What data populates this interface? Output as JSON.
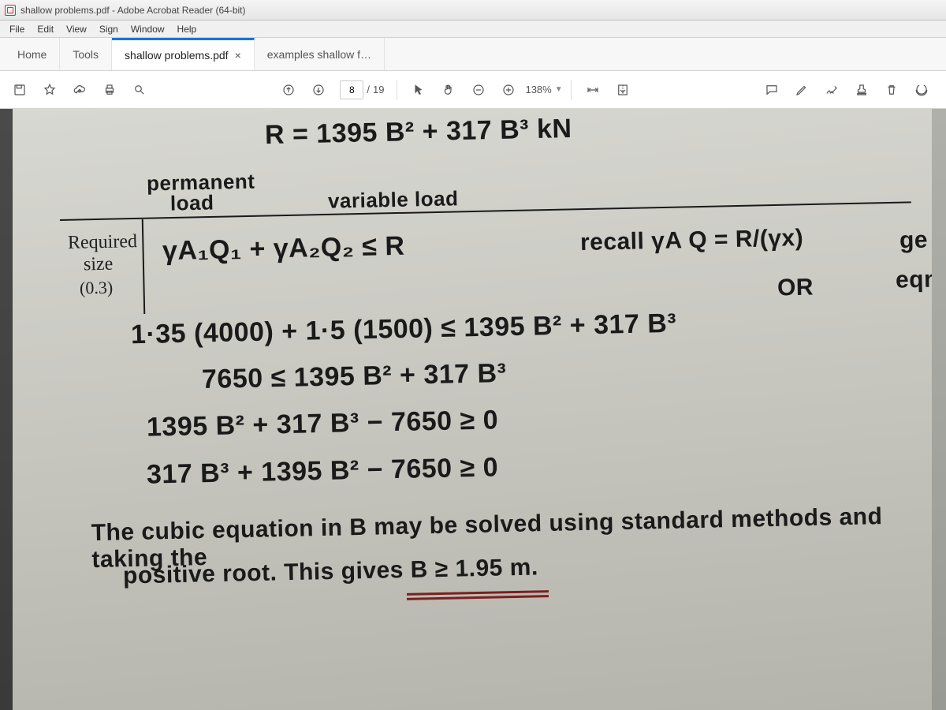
{
  "window": {
    "title": "shallow problems.pdf - Adobe Acrobat Reader (64-bit)"
  },
  "menu": {
    "file": "File",
    "edit": "Edit",
    "view": "View",
    "sign": "Sign",
    "window": "Window",
    "help": "Help"
  },
  "tabs": {
    "home": "Home",
    "tools": "Tools",
    "doc_active": "shallow problems.pdf",
    "doc_other": "examples shallow f…"
  },
  "toolbar": {
    "page_current": "8",
    "page_sep": "/",
    "page_total": "19",
    "zoom": "138%"
  },
  "document": {
    "eq_R": "R = 1395 B² + 317 B³ kN",
    "label_permanent": "permanent",
    "label_load_top": "load",
    "label_variable_load": "variable load",
    "printed_required": "Required",
    "printed_size": "size",
    "printed_03": "(0.3)",
    "line_req": "γA₁Q₁ + γA₂Q₂ ≤ R",
    "recall": "recall  γA Q = R/(γx)",
    "recall_or": "OR",
    "ge": "ge",
    "eqn_side": "eqn",
    "line1": "1·35 (4000) + 1·5 (1500) ≤ 1395 B² + 317 B³",
    "line2": "7650 ≤ 1395 B² + 317 B³",
    "line3": "1395 B² + 317 B³ − 7650 ≥ 0",
    "line4": "317 B³ + 1395 B² − 7650 ≥ 0",
    "line5": "The cubic equation in B may be solved using standard methods and taking the",
    "line6": "positive root. This gives  B ≥ 1.95 m."
  }
}
